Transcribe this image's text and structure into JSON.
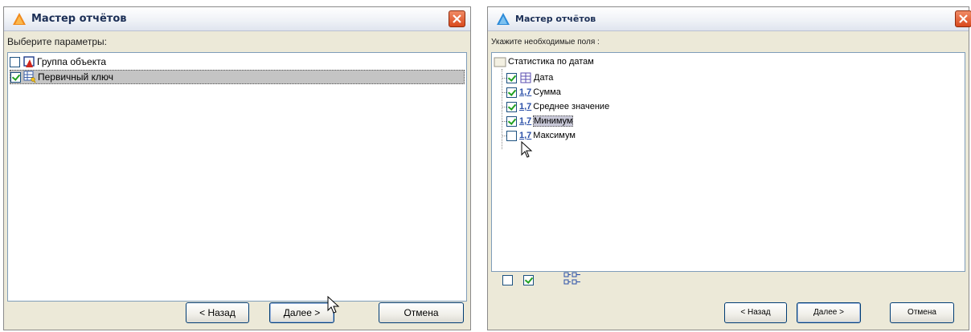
{
  "dialog1": {
    "title": "Мастер отчётов",
    "prompt": "Выберите параметры:",
    "items": [
      {
        "label": "Группа объекта",
        "checked": false
      },
      {
        "label": "Первичный ключ",
        "checked": true
      }
    ],
    "buttons": {
      "back": "< Назад",
      "next": "Далее >",
      "cancel": "Отмена"
    }
  },
  "dialog2": {
    "title": "Мастер отчётов",
    "prompt": "Укажите необходимые поля :",
    "root": "Статистика по датам",
    "fields": [
      {
        "icon_text": "",
        "label": "Дата",
        "checked": true
      },
      {
        "icon_text": "1,7",
        "label": "Сумма",
        "checked": true
      },
      {
        "icon_text": "1,7",
        "label": "Среднее значение",
        "checked": true
      },
      {
        "icon_text": "1,7",
        "label": "Минимум",
        "checked": true
      },
      {
        "icon_text": "1,7",
        "label": "Максимум",
        "checked": false
      }
    ],
    "buttons": {
      "back": "< Назад",
      "next": "Далее >",
      "cancel": "Отмена"
    }
  },
  "colors": {
    "titlebar_text": "#1c2f56",
    "close_button": "#d9491c",
    "check": "#21a121",
    "selection": "#c4c4c4"
  }
}
